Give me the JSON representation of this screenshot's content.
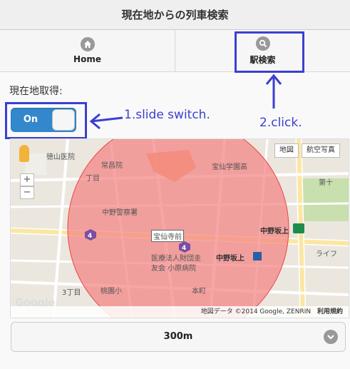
{
  "header": {
    "title": "現在地からの列車検索"
  },
  "nav": {
    "items": [
      {
        "label": "Home",
        "icon": "home-icon"
      },
      {
        "label": "駅検索",
        "icon": "search-icon"
      }
    ]
  },
  "location": {
    "label": "現在地取得:",
    "switch_label": "On",
    "switch_on": true
  },
  "annotations": {
    "slide": "1.slide switch.",
    "click": "2.click."
  },
  "map": {
    "map_btn": "地図",
    "aerial_btn": "航空写真",
    "zoom_in": "+",
    "zoom_out": "−",
    "credit": "地図データ ©2014 Google, ZENRIN",
    "terms": "利用規約",
    "google": "Google",
    "labels": {
      "tokuyama": "徳山医院",
      "joshouin": "常昌院",
      "chome2": "丁目",
      "houzen_hs": "宝仙学園高",
      "nakano_police": "中野警察署",
      "houzenji_mae": "宝仙寺前",
      "nakano_sakaue_top": "中野坂上",
      "nakano_sakaue_station": "中野坂上",
      "kosaka_hosp_1": "医療法人財団圭",
      "kosaka_hosp_2": "友会 小原病院",
      "chome3": "3丁目",
      "momozono": "桃園小",
      "honcho": "本町",
      "dai10": "第十",
      "raifu": "ライフ",
      "route_badge": "4"
    }
  },
  "select": {
    "value": "300m"
  },
  "colors": {
    "accent": "#3388cc",
    "annotation": "#3b3fd1",
    "circle": "#ee4444"
  }
}
